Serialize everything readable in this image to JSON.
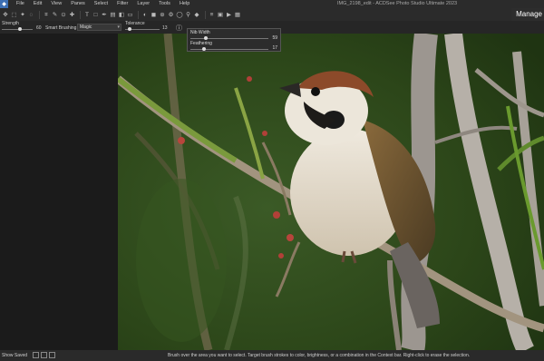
{
  "menubar": {
    "items": [
      "File",
      "Edit",
      "View",
      "Panes",
      "Select",
      "Filter",
      "Layer",
      "Tools",
      "Help"
    ],
    "window_title": "IMG_2198_edit - ACDSee Photo Studio Ultimate 2023"
  },
  "toolbar": {
    "icons": [
      "move-icon",
      "select-icon",
      "wand-icon",
      "lasso-icon",
      "crop-icon",
      "brush-icon",
      "clone-icon",
      "repair-icon",
      "text-icon",
      "shape-icon",
      "pen-icon",
      "gradient-icon",
      "fill-icon",
      "eraser-icon",
      "dodge-icon",
      "color-icon"
    ],
    "manage_label": "Manage"
  },
  "context_bar": {
    "strength_label": "Strength",
    "strength_value": "60",
    "strength_fraction": 0.6,
    "smart_brushing_label": "Smart Brushing",
    "smart_brushing_mode": "Magic",
    "tolerance_label": "Tolerance",
    "tolerance_value": "13",
    "tolerance_fraction": 0.13
  },
  "nib_popup": {
    "nib_width_label": "Nib Width",
    "nib_width_value": "59",
    "nib_width_fraction": 0.2,
    "feathering_label": "Feathering",
    "feathering_value": "17",
    "feathering_fraction": 0.17
  },
  "statusbar": {
    "show_saved_label": "Show Saved",
    "message": "Brush over the area you want to select. Target brush strokes to color, brightness, or a combination in the Context bar. Right-click to erase the selection."
  }
}
